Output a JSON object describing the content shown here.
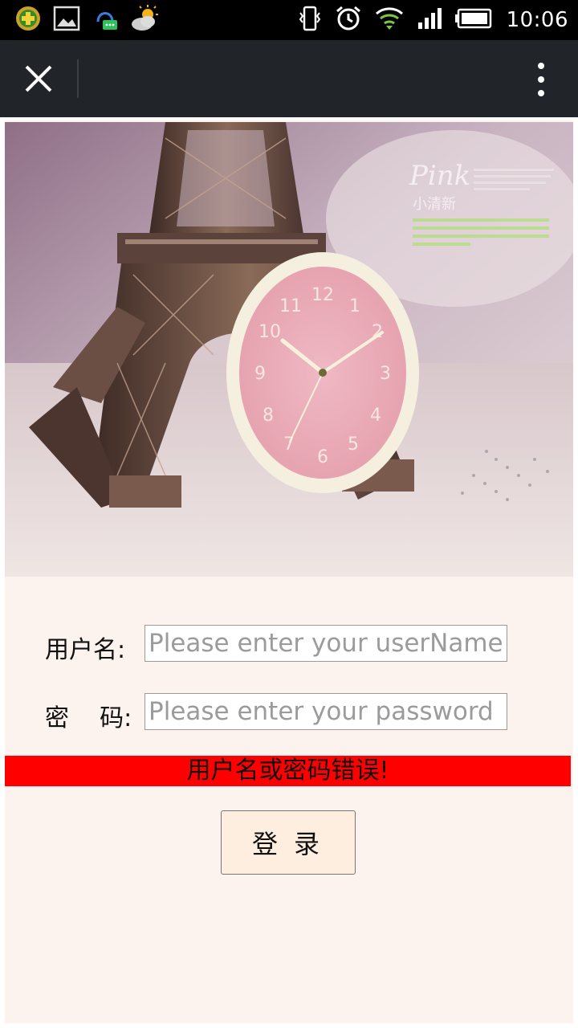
{
  "status_bar": {
    "time": "10:06",
    "left_icons": [
      "app-plus-icon",
      "image-icon",
      "qq-icon",
      "weather-icon"
    ],
    "right_icons": [
      "vibrate-icon",
      "alarm-icon",
      "wifi-icon",
      "signal-icon",
      "battery-icon"
    ]
  },
  "top_bar": {
    "close_icon": "close-icon",
    "menu_icon": "more-vert-icon"
  },
  "hero": {
    "text_pink": "Pink",
    "text_title": "小清新"
  },
  "form": {
    "username_label": "用户名:",
    "username_placeholder": "Please enter your userName",
    "username_value": "",
    "password_label": "密    码:",
    "password_placeholder": "Please enter your password",
    "password_value": ""
  },
  "error_message": "用户名或密码错误!",
  "login_button": "登录",
  "colors": {
    "error_bg": "#ff0000",
    "page_bg": "#fdf3ee",
    "toolbar_bg": "#212529"
  }
}
